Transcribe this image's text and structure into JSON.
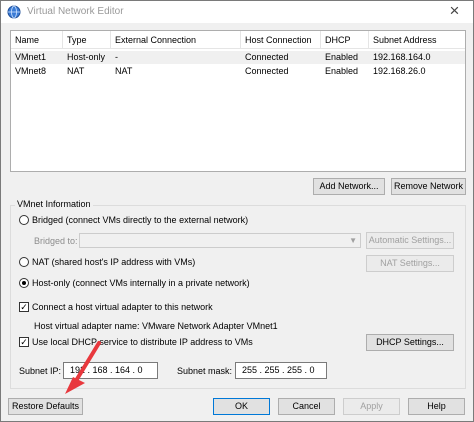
{
  "window": {
    "title": "Virtual Network Editor",
    "close_glyph": "×",
    "accent": "#0078d7"
  },
  "table": {
    "columns": [
      "Name",
      "Type",
      "External Connection",
      "Host Connection",
      "DHCP",
      "Subnet Address"
    ],
    "rows": [
      [
        "VMnet1",
        "Host-only",
        "-",
        "Connected",
        "Enabled",
        "192.168.164.0"
      ],
      [
        "VMnet8",
        "NAT",
        "NAT",
        "Connected",
        "Enabled",
        "192.168.26.0"
      ]
    ]
  },
  "table_buttons": {
    "add_network": "Add Network...",
    "remove_network": "Remove Network"
  },
  "vmnet_info": {
    "group_label": "VMnet Information",
    "bridged_label": "Bridged (connect VMs directly to the external network)",
    "bridged_to_label": "Bridged to:",
    "bridged_to_value": "",
    "automatic_settings": "Automatic Settings...",
    "nat_label": "NAT (shared host's IP address with VMs)",
    "nat_settings": "NAT Settings...",
    "hostonly_label": "Host-only (connect VMs internally in a private network)",
    "selected_mode": "host-only",
    "connect_adapter_label": "Connect a host virtual adapter to this network",
    "connect_adapter_checked": true,
    "adapter_name_label": "Host virtual adapter name: VMware Network Adapter VMnet1",
    "dhcp_label": "Use local DHCP service to distribute IP address to VMs",
    "dhcp_checked": true,
    "dhcp_settings": "DHCP Settings...",
    "subnet_ip_label": "Subnet IP:",
    "subnet_ip_value": "192 . 168 . 164 . 0",
    "subnet_mask_label": "Subnet mask:",
    "subnet_mask_value": "255 . 255 . 255 . 0"
  },
  "footer": {
    "restore_defaults": "Restore Defaults",
    "ok": "OK",
    "cancel": "Cancel",
    "apply": "Apply",
    "help": "Help"
  },
  "annotation": {
    "arrow_color": "#e8383d",
    "arrow_icon": "red-arrow-icon"
  }
}
